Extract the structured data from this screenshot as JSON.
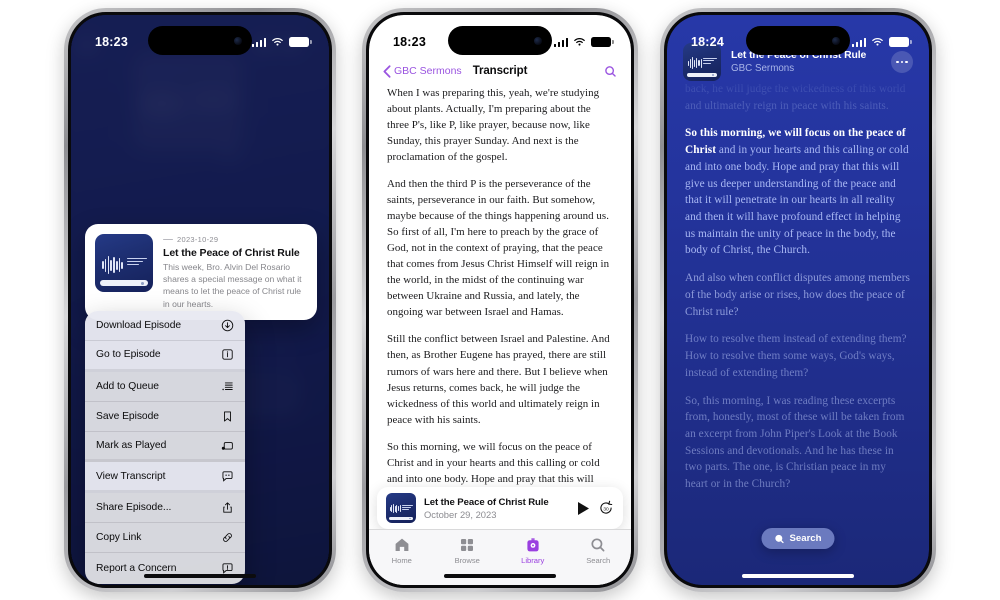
{
  "phone1": {
    "status": {
      "time": "18:23"
    },
    "episode_card": {
      "date": "2023-10-29",
      "title": "Let the Peace of Christ Rule",
      "description": "This week, Bro. Alvin Del Rosario shares a special message on what it means to let the peace of Christ rule in our hearts."
    },
    "context_menu": [
      {
        "label": "Download Episode",
        "icon": "download-circle-icon",
        "highlighted": true
      },
      {
        "label": "Go to Episode",
        "icon": "info-square-icon",
        "highlighted": true
      },
      {
        "label": "Add to Queue",
        "icon": "queue-list-icon",
        "highlighted": false
      },
      {
        "label": "Save Episode",
        "icon": "bookmark-icon",
        "highlighted": false
      },
      {
        "label": "Mark as Played",
        "icon": "mark-played-icon",
        "highlighted": false
      },
      {
        "label": "View Transcript",
        "icon": "transcript-bubble-icon",
        "highlighted": true
      },
      {
        "label": "Share Episode...",
        "icon": "share-icon",
        "highlighted": false
      },
      {
        "label": "Copy Link",
        "icon": "link-icon",
        "highlighted": false
      },
      {
        "label": "Report a Concern",
        "icon": "report-bubble-icon",
        "highlighted": false
      }
    ]
  },
  "phone2": {
    "status": {
      "time": "18:23"
    },
    "nav": {
      "back_label": "GBC Sermons",
      "title": "Transcript",
      "search_icon": "search-icon"
    },
    "transcript_paragraphs": [
      "When I was preparing this, yeah, we're studying about plants. Actually, I'm preparing about the three P's, like P, like prayer, because now, like Sunday, this prayer Sunday. And next is the proclamation of the gospel.",
      "And then the third P is the perseverance of the saints, perseverance in our faith. But somehow, maybe because of the things happening around us. So first of all, I'm here to preach by the grace of God, not in the context of praying, that the peace that comes from Jesus Christ Himself will reign in the world, in the midst of the continuing war between Ukraine and Russia, and lately, the ongoing war between Israel and Hamas.",
      "Still the conflict between Israel and Palestine. And then, as Brother Eugene has prayed, there are still rumors of wars here and there. But I believe when Jesus returns, comes back, he will judge the wickedness of this world and ultimately reign in peace with his saints.",
      "So this morning, we will focus on the peace of Christ and in your hearts and this calling or cold and into one body. Hope and pray that this will give us deeper understanding of the peace and that it will penetrate in our hearts in all reality and then it will have profound effect in helping us maintain the unity of peace in the body, the body of Christ, the Church. And also when conflict disputes among members of the body arise or"
    ],
    "mini_player": {
      "title": "Let the Peace of Christ Rule",
      "date": "October 29, 2023",
      "play_icon": "play-icon",
      "skip_icon": "skip-forward-30-icon"
    },
    "tabs": [
      {
        "label": "Home",
        "icon": "home-icon",
        "active": false
      },
      {
        "label": "Browse",
        "icon": "grid-icon",
        "active": false
      },
      {
        "label": "Library",
        "icon": "library-podcast-icon",
        "active": true
      },
      {
        "label": "Search",
        "icon": "search-icon",
        "active": false
      }
    ]
  },
  "phone3": {
    "status": {
      "time": "18:24"
    },
    "header": {
      "title": "Let the Peace of Christ Rule",
      "subtitle": "GBC Sermons",
      "more_icon": "more-dots-icon"
    },
    "transcript": {
      "previous": "back, he will judge the wickedness of this world and ultimately reign in peace with his saints.",
      "active_highlight": "So this morning, we will focus on the peace of Christ",
      "active_rest": " and in your hearts and this calling or cold and into one body. Hope and pray that this will give us deeper understanding of the peace and that it will penetrate in our hearts in all reality and then it will have profound effect in helping us maintain the unity of peace in the body, the body of Christ, the Church.",
      "upcoming": [
        "And also when conflict disputes among members of the body arise or rises, how does the peace of Christ rule?",
        "How to resolve them instead of extending them? How to resolve them some ways, God's ways, instead of extending them?",
        "So, this morning, I was reading these excerpts from, honestly, most of these will be taken from an excerpt from John Piper's Look at the Book Sessions and devotionals. And he has these in two parts. The one, is Christian peace in my heart or in the Church?"
      ]
    },
    "search_button": {
      "label": "Search",
      "icon": "search-icon"
    }
  },
  "colors": {
    "accent_purple": "#9a54e0",
    "library_purple": "#9a3fe0",
    "phone3_bg": "#24349d",
    "phone1_bg": "#17205c",
    "artwork_navy": "#1d2e70"
  }
}
